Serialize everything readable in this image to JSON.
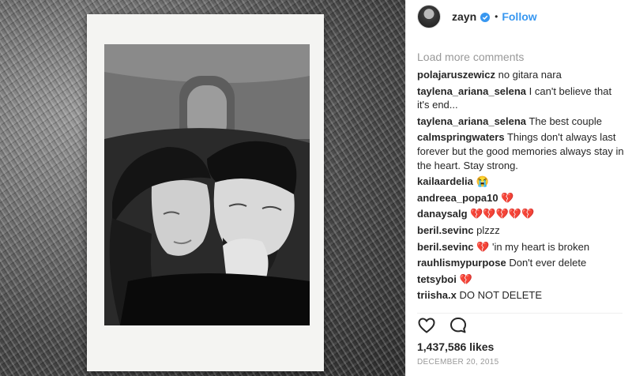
{
  "post": {
    "author": {
      "username": "zayn",
      "verified": true,
      "follow_label": "Follow",
      "separator": "•"
    },
    "comments_header": {
      "load_more_label": "Load more comments"
    },
    "comments": [
      {
        "author": "polajaruszewicz",
        "text": "no gitara nara"
      },
      {
        "author": "taylena_ariana_selena",
        "text": "I can't believe that it's end..."
      },
      {
        "author": "taylena_ariana_selena",
        "text": "The best couple"
      },
      {
        "author": "calmspringwaters",
        "text": "Things don't always last forever but the good memories always stay in the heart. Stay strong."
      },
      {
        "author": "kailaardelia",
        "text": "😭"
      },
      {
        "author": "andreea_popa10",
        "text": "💔"
      },
      {
        "author": "danaysalg",
        "text": "💔💔💔💔💔"
      },
      {
        "author": "beril.sevinc",
        "text": "plzzz"
      },
      {
        "author": "beril.sevinc",
        "text": "💔 'in my heart is broken"
      },
      {
        "author": "rauhlismypurpose",
        "text": "Don't ever delete"
      },
      {
        "author": "tetsyboi",
        "text": "💔"
      },
      {
        "author": "triisha.x",
        "text": "DO NOT DELETE"
      }
    ],
    "actions": {
      "like_icon": "heart-outline-icon",
      "comment_icon": "speech-bubble-icon"
    },
    "likes_label": "1,437,586 likes",
    "date_label": "DECEMBER 20, 2015"
  },
  "colors": {
    "accent": "#3897f0",
    "text": "#262626",
    "muted": "#999999",
    "heart": "#e0162b"
  }
}
